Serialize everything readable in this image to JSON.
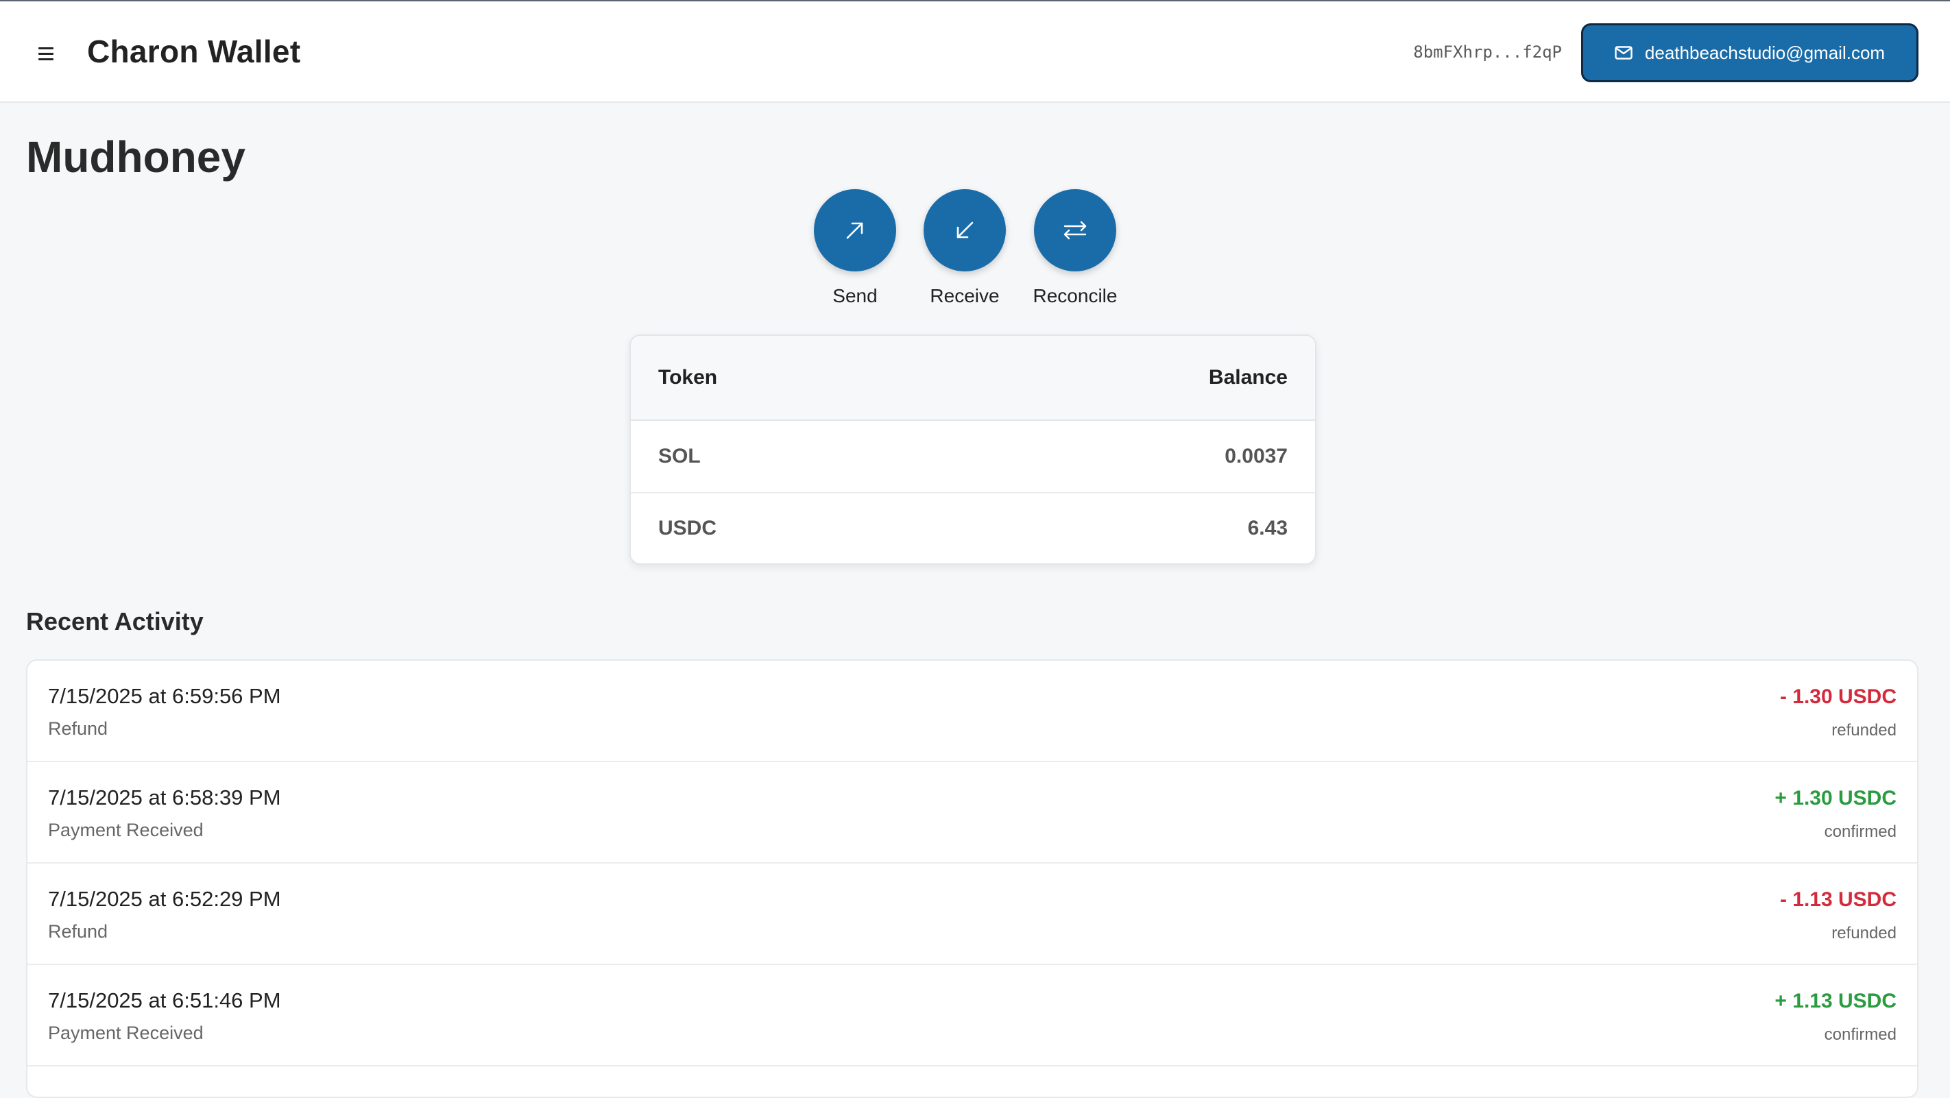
{
  "header": {
    "title": "Charon Wallet",
    "wallet_address": "8bmFXhrp...f2qP",
    "email": "deathbeachstudio@gmail.com",
    "menu_icon": "hamburger-icon",
    "email_icon": "mail-icon"
  },
  "page": {
    "title": "Mudhoney"
  },
  "actions": [
    {
      "label": "Send",
      "icon": "arrow-up-right-icon"
    },
    {
      "label": "Receive",
      "icon": "arrow-down-left-icon"
    },
    {
      "label": "Reconcile",
      "icon": "swap-arrows-icon"
    }
  ],
  "balances": {
    "headers": {
      "token": "Token",
      "balance": "Balance"
    },
    "rows": [
      {
        "token": "SOL",
        "balance": "0.0037"
      },
      {
        "token": "USDC",
        "balance": "6.43"
      }
    ]
  },
  "activity": {
    "title": "Recent Activity",
    "items": [
      {
        "timestamp": "7/15/2025 at 6:59:56 PM",
        "type": "Refund",
        "amount": "- 1.30 USDC",
        "status": "refunded",
        "direction": "out"
      },
      {
        "timestamp": "7/15/2025 at 6:58:39 PM",
        "type": "Payment Received",
        "amount": "+ 1.30 USDC",
        "status": "confirmed",
        "direction": "in"
      },
      {
        "timestamp": "7/15/2025 at 6:52:29 PM",
        "type": "Refund",
        "amount": "- 1.13 USDC",
        "status": "refunded",
        "direction": "out"
      },
      {
        "timestamp": "7/15/2025 at 6:51:46 PM",
        "type": "Payment Received",
        "amount": "+ 1.13 USDC",
        "status": "confirmed",
        "direction": "in"
      }
    ]
  },
  "colors": {
    "primary": "#1a6ca8",
    "negative": "#d32b3c",
    "positive": "#2a9b3f",
    "background": "#f6f7f9"
  }
}
